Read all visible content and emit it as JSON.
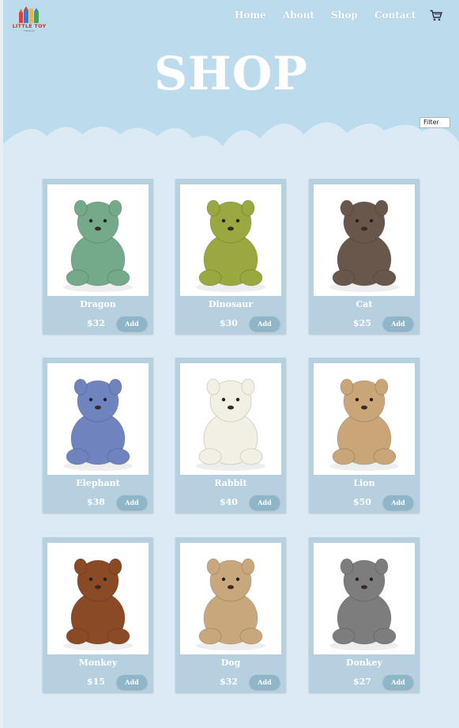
{
  "brand": {
    "logo_text": "LITTLE TOY",
    "logo_sub": "EMPORIUM"
  },
  "nav": {
    "home": "Home",
    "about": "About",
    "shop": "Shop",
    "contact": "Contact"
  },
  "page_title": "SHOP",
  "filter": {
    "label": "Filter"
  },
  "colors": {
    "background": "#dbeaf5",
    "header": "#bcdcee",
    "card": "#b6d0e0",
    "button": "#8fb5c8"
  },
  "products": [
    {
      "name": "Dragon",
      "price": "$32",
      "add_label": "Add",
      "color": "#74a98a"
    },
    {
      "name": "Dinosaur",
      "price": "$30",
      "add_label": "Add",
      "color": "#9aa83f"
    },
    {
      "name": "Cat",
      "price": "$25",
      "add_label": "Add",
      "color": "#6a574c"
    },
    {
      "name": "Elephant",
      "price": "$38",
      "add_label": "Add",
      "color": "#6f83bf"
    },
    {
      "name": "Rabbit",
      "price": "$40",
      "add_label": "Add",
      "color": "#f2efe4"
    },
    {
      "name": "Lion",
      "price": "$50",
      "add_label": "Add",
      "color": "#c9a577"
    },
    {
      "name": "Monkey",
      "price": "$15",
      "add_label": "Add",
      "color": "#8a4a26"
    },
    {
      "name": "Dog",
      "price": "$32",
      "add_label": "Add",
      "color": "#c8a77c"
    },
    {
      "name": "Donkey",
      "price": "$27",
      "add_label": "Add",
      "color": "#7d7d7d"
    }
  ]
}
